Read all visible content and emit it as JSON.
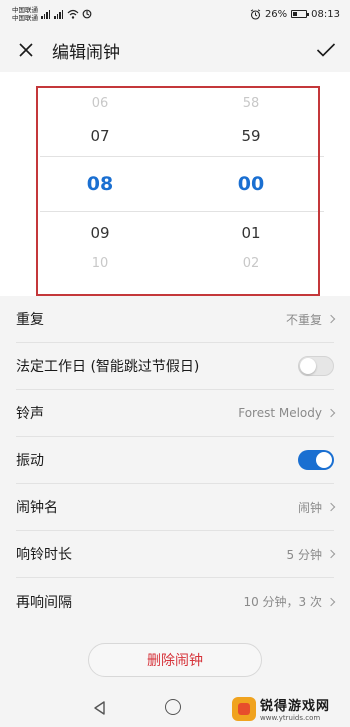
{
  "status_bar": {
    "carrier_1": "中国联通",
    "carrier_2": "中国联通",
    "battery": "26%",
    "time": "08:13"
  },
  "header": {
    "title": "编辑闹钟",
    "close_icon": "close-icon",
    "confirm_icon": "check-icon"
  },
  "picker": {
    "hours": [
      "06",
      "07",
      "08",
      "09",
      "10"
    ],
    "minutes": [
      "58",
      "59",
      "00",
      "01",
      "02"
    ],
    "selected_hour": "08",
    "selected_minute": "00",
    "accent_color": "#1a6fd1",
    "highlight_color": "#c4373a"
  },
  "settings": {
    "repeat": {
      "label": "重复",
      "value": "不重复"
    },
    "workday": {
      "label": "法定工作日 (智能跳过节假日)",
      "enabled": false
    },
    "ringtone": {
      "label": "铃声",
      "value": "Forest Melody"
    },
    "vibrate": {
      "label": "振动",
      "enabled": true
    },
    "name": {
      "label": "闹钟名",
      "value": "闹钟"
    },
    "duration": {
      "label": "响铃时长",
      "value": "5 分钟"
    },
    "snooze": {
      "label": "再响间隔",
      "value": "10 分钟，3 次"
    }
  },
  "delete_button": {
    "label": "删除闹钟",
    "color": "#d6333a"
  },
  "watermark": {
    "title": "锐得游戏网",
    "url": "www.ytruids.com"
  }
}
